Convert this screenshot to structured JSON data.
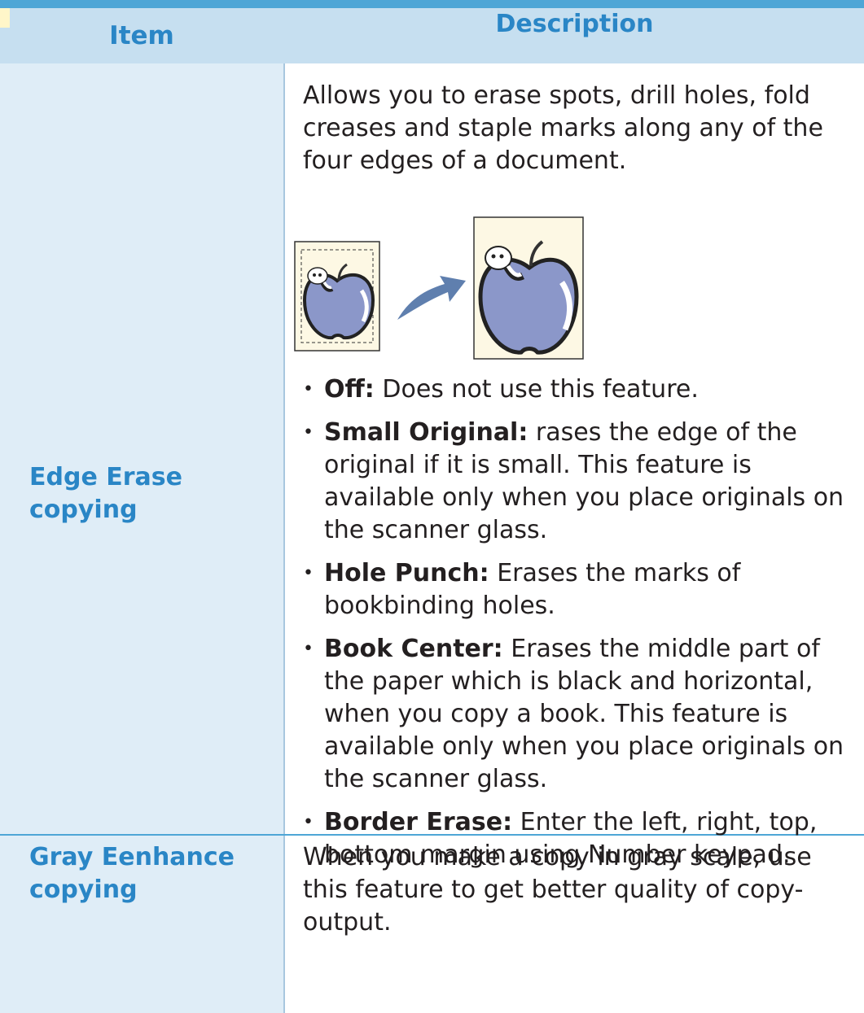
{
  "table": {
    "header": {
      "item": "Item",
      "description": "Description"
    },
    "rows": [
      {
        "item": "Edge Erase copying",
        "intro": "Allows you to erase spots, drill holes, fold creases and staple marks along any of the four edges of a document.",
        "options": [
          {
            "name": "Off:",
            "text": "Does not use this feature."
          },
          {
            "name": "Small Original:",
            "text": "rases the edge of the original if it is small. This feature is available only when you place originals on the scanner glass."
          },
          {
            "name": "Hole Punch:",
            "text": "Erases the marks of bookbinding holes."
          },
          {
            "name": "Book Center:",
            "text": "Erases the middle part of the paper which is black and horizontal, when you copy a book. This feature is available only when you place originals on the scanner glass."
          },
          {
            "name": "Border Erase:",
            "text": "Enter the left, right, top, bottom margin using Number keypad."
          }
        ]
      },
      {
        "item": "Gray Eenhance copying",
        "description": "When you make a copy in gray scale, use this feature to get better quality of copy-output."
      }
    ]
  },
  "colors": {
    "accent": "#2a86c6",
    "header_bg": "#c6dff0",
    "item_col_bg": "#dfedf7",
    "apple": "#8b97c9",
    "illustration_bg": "#fdf8e4"
  }
}
